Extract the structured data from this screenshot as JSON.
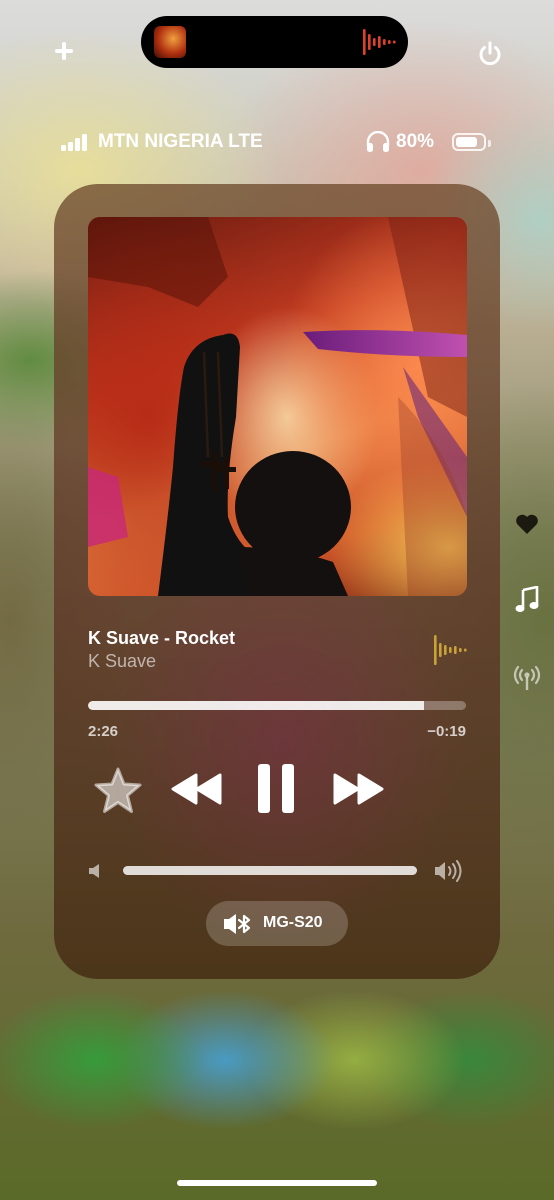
{
  "status_bar": {
    "carrier": "MTN NIGERIA LTE",
    "signal_bars": 4,
    "battery_percent": "80%",
    "battery_level": 0.8,
    "headphones_icon": "airpods-icon"
  },
  "top_bar": {
    "add_icon": "plus-icon",
    "power_icon": "power-icon"
  },
  "dynamic_island": {
    "artwork_icon": "album-thumbnail",
    "waveform_icon": "waveform-icon",
    "waveform_color": "#e0412a"
  },
  "now_playing": {
    "title": "K Suave - Rocket",
    "artist": "K Suave",
    "waveform_color": "#c9a33a",
    "progress": 0.89,
    "elapsed": "2:26",
    "remaining": "−0:19",
    "volume": 1.0
  },
  "controls": {
    "favorite_icon": "star-icon",
    "previous_icon": "backward-icon",
    "play_pause_icon": "pause-icon",
    "next_icon": "forward-icon",
    "volume_low_icon": "speaker-low-icon",
    "volume_high_icon": "speaker-high-icon"
  },
  "output": {
    "device": "MG-S20",
    "icon": "speaker-bluetooth-icon"
  },
  "side_controls": [
    "heart-icon",
    "music-note-icon",
    "broadcast-icon"
  ]
}
